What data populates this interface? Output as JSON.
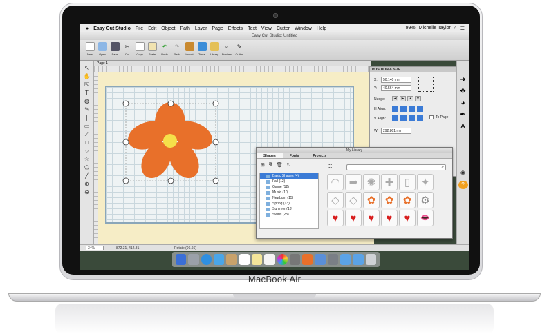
{
  "laptop": {
    "model": "MacBook Air"
  },
  "menubar": {
    "apple": "",
    "app": "Easy Cut Studio",
    "items": [
      "File",
      "Edit",
      "Object",
      "Path",
      "Layer",
      "Page",
      "Effects",
      "Text",
      "View",
      "Cutter",
      "Window",
      "Help"
    ],
    "battery": "99%",
    "user": "Michelle Taylor"
  },
  "window": {
    "title": "Easy Cut Studio: Untitled"
  },
  "toolbar": {
    "buttons": [
      "New",
      "Open",
      "Save",
      "Cut",
      "Copy",
      "Paste",
      "Undo",
      "Redo",
      "Import",
      "Trace",
      "Library",
      "Preview",
      "Cutter"
    ]
  },
  "tab": {
    "label": "Page 1"
  },
  "position_panel": {
    "title": "POSITION & SIZE",
    "x_label": "X:",
    "x_value": "50.140 mm",
    "y_label": "Y:",
    "y_value": "40.564 mm",
    "nudge_label": "Nudge:",
    "halign_label": "H Align:",
    "valign_label": "V Align:",
    "to_page_label": "To Page",
    "w_label": "W:",
    "w_value": "292.801 mm"
  },
  "library": {
    "title": "My Library",
    "tabs": [
      "Shapes",
      "Fonts",
      "Projects"
    ],
    "tree": [
      "Basic Shapes (4)",
      "Fall (12)",
      "Game (12)",
      "Music (10)",
      "Newborn (15)",
      "Spring (13)",
      "Summer (16)",
      "Swirls (23)"
    ],
    "shapes": [
      "◠",
      "➡",
      "✺",
      "✚",
      "▯",
      "✦",
      "◇",
      "◇",
      "✿",
      "✿",
      "✿",
      "⚙",
      "♥",
      "♥",
      "♥",
      "♥",
      "♥",
      "👄",
      "⬭",
      "⬭"
    ]
  },
  "statusbar": {
    "zoom": "34%",
    "coords": "872.31, 412.81",
    "rotate": "Rotate (06.66)"
  },
  "colors": {
    "flower": "#e8702a",
    "flower_center": "#f5e04a",
    "selection": "#3b7bd6"
  }
}
